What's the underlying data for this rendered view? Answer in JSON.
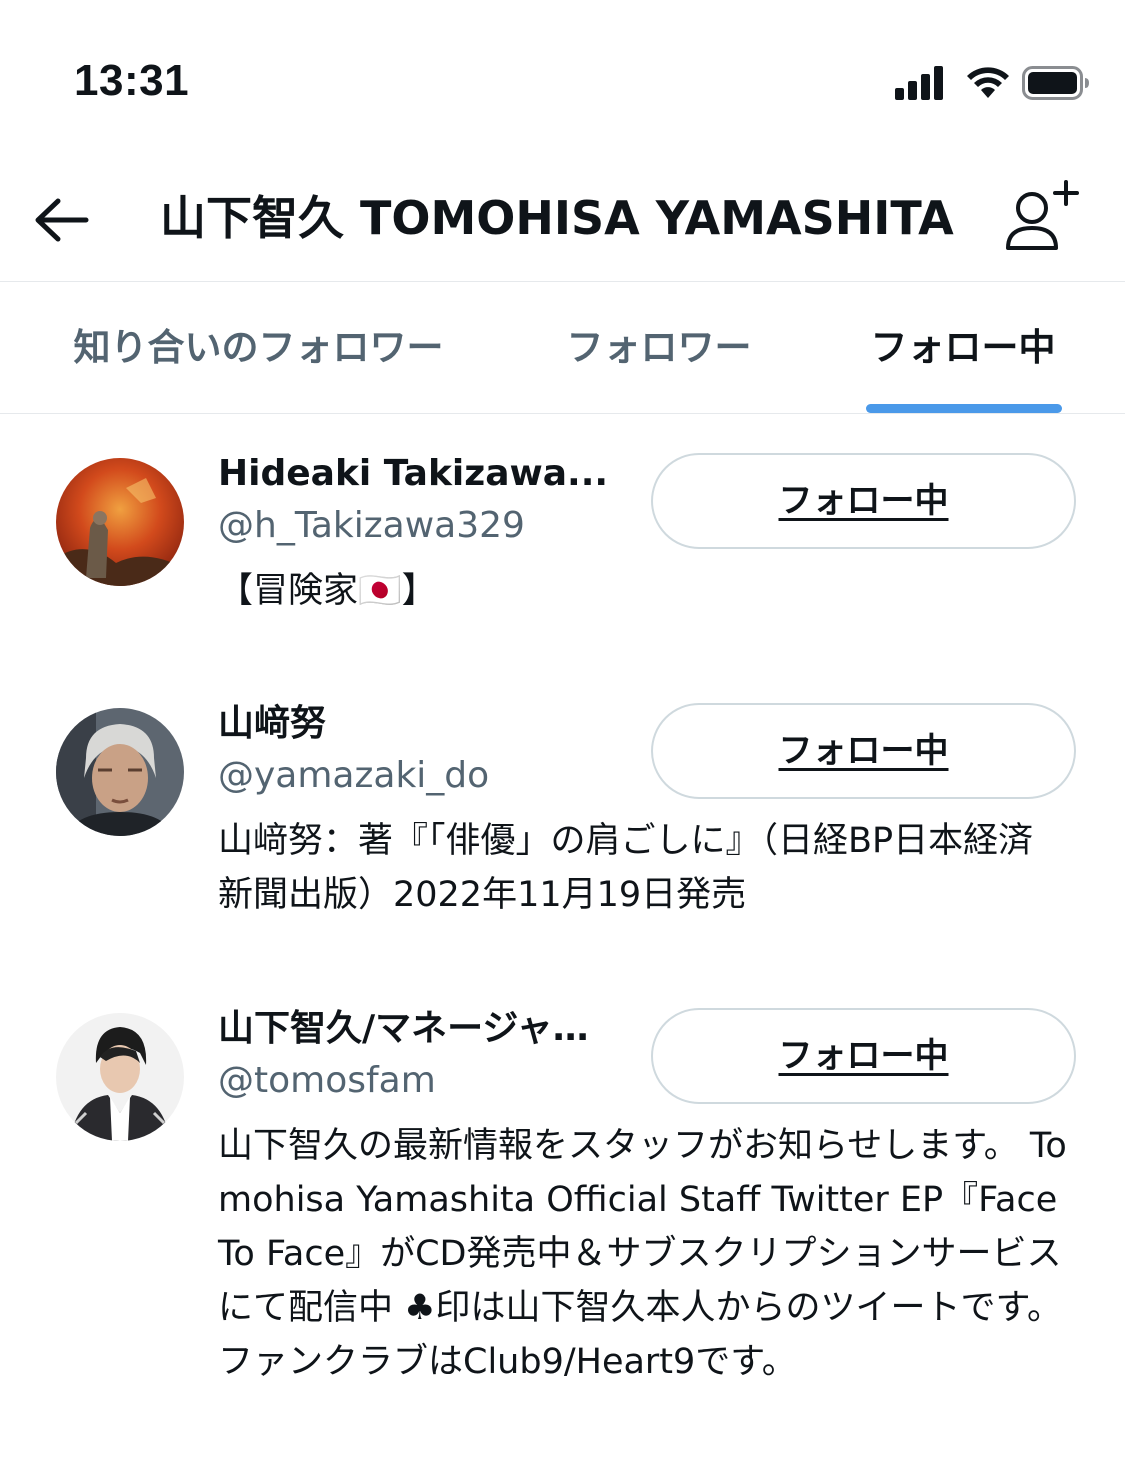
{
  "status_bar": {
    "time": "13:31",
    "icons": [
      "signal-icon",
      "wifi-icon",
      "battery-icon"
    ]
  },
  "header": {
    "back_icon": "arrow-left-icon",
    "title": "山下智久 TOMOHISA YAMASHITA",
    "add_user_icon": "add-user-icon"
  },
  "tabs": [
    {
      "label": "知り合いのフォロワー",
      "active": false
    },
    {
      "label": "フォロワー",
      "active": false
    },
    {
      "label": "フォロー中",
      "active": true
    }
  ],
  "accent_color": "#4a99e9",
  "users": [
    {
      "name": "Hideaki Takizawa...",
      "handle": "@h_Takizawa329",
      "bio": "【冒険家🇯🇵】",
      "follow_label": "フォロー中"
    },
    {
      "name": "山﨑努",
      "handle": "@yamazaki_do",
      "bio": "山﨑努：著『「俳優」の肩ごしに』（日経BP日本経済新聞出版）2022年11月19日発売",
      "follow_label": "フォロー中"
    },
    {
      "name": "山下智久/マネージャ…",
      "handle": "@tomosfam",
      "bio": "山下智久の最新情報をスタッフがお知らせします。 Tomohisa Yamashita Official Staff Twitter EP『Face To Face』がCD発売中＆サブスクリプションサービスにて配信中 ♣印は山下智久本人からのツイートです。ファンクラブはClub9/Heart9です。",
      "follow_label": "フォロー中"
    }
  ]
}
